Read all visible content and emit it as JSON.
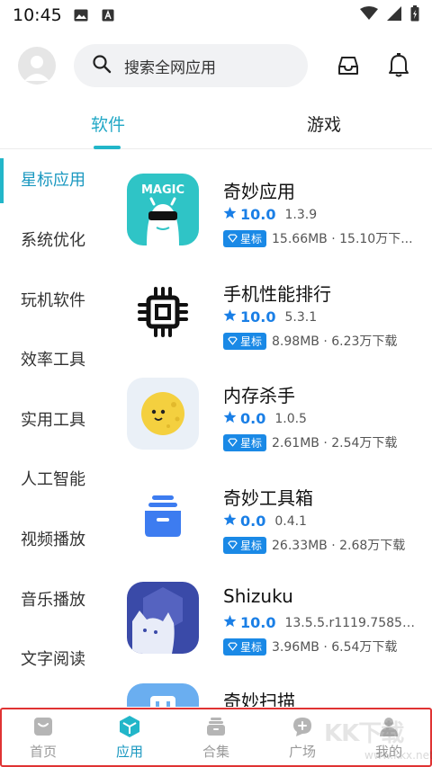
{
  "statusbar": {
    "time": "10:45"
  },
  "header": {
    "search_placeholder": "搜索全网应用"
  },
  "tabs": [
    {
      "label": "软件",
      "active": true
    },
    {
      "label": "游戏",
      "active": false
    }
  ],
  "sidebar": {
    "items": [
      {
        "label": "星标应用",
        "active": true
      },
      {
        "label": "系统优化"
      },
      {
        "label": "玩机软件"
      },
      {
        "label": "效率工具"
      },
      {
        "label": "实用工具"
      },
      {
        "label": "人工智能"
      },
      {
        "label": "视频播放"
      },
      {
        "label": "音乐播放"
      },
      {
        "label": "文字阅读"
      }
    ]
  },
  "apps": [
    {
      "name": "奇妙应用",
      "score": "10.0",
      "version": "1.3.9",
      "badge": "星标",
      "stats": "15.66MB · 15.10万下...",
      "icon_label": "MAGIC"
    },
    {
      "name": "手机性能排行",
      "score": "10.0",
      "version": "5.3.1",
      "badge": "星标",
      "stats": "8.98MB · 6.23万下载"
    },
    {
      "name": "内存杀手",
      "score": "0.0",
      "version": "1.0.5",
      "badge": "星标",
      "stats": "2.61MB · 2.54万下载"
    },
    {
      "name": "奇妙工具箱",
      "score": "0.0",
      "version": "0.4.1",
      "badge": "星标",
      "stats": "26.33MB · 2.68万下载"
    },
    {
      "name": "Shizuku",
      "score": "10.0",
      "version": "13.5.5.r1119.75853...",
      "badge": "星标",
      "stats": "3.96MB · 6.54万下载"
    },
    {
      "name": "奇妙扫描"
    }
  ],
  "bottom_nav": [
    {
      "label": "首页"
    },
    {
      "label": "应用",
      "active": true
    },
    {
      "label": "合集"
    },
    {
      "label": "广场"
    },
    {
      "label": "我的"
    }
  ],
  "watermark": {
    "main": "KK下载",
    "sub": "www.kkx.net"
  },
  "colors": {
    "accent": "#22b6c9",
    "active_text": "#1a98c0",
    "score": "#1a7fe6",
    "badge": "#1a89e6",
    "highlight_border": "#e03333"
  }
}
